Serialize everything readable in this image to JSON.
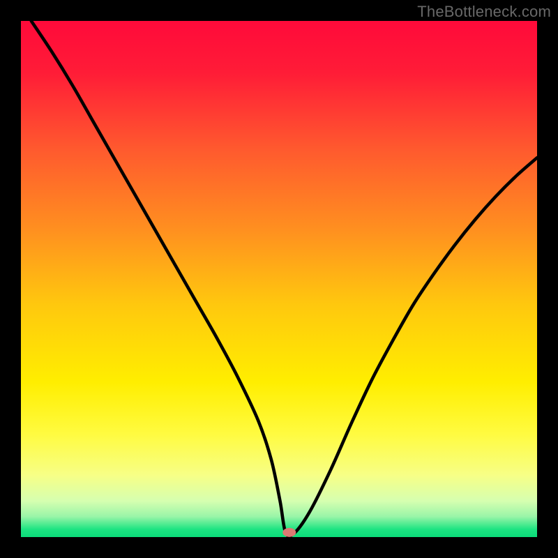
{
  "watermark": "TheBottleneck.com",
  "chart_data": {
    "type": "line",
    "title": "",
    "xlabel": "",
    "ylabel": "",
    "xlim": [
      0,
      100
    ],
    "ylim": [
      0,
      100
    ],
    "background_gradient": {
      "stops": [
        {
          "pos": 0.0,
          "color": "#ff0a3a"
        },
        {
          "pos": 0.1,
          "color": "#ff1c37"
        },
        {
          "pos": 0.25,
          "color": "#ff5a2e"
        },
        {
          "pos": 0.4,
          "color": "#ff8e20"
        },
        {
          "pos": 0.55,
          "color": "#ffc80e"
        },
        {
          "pos": 0.7,
          "color": "#ffee00"
        },
        {
          "pos": 0.8,
          "color": "#fffb40"
        },
        {
          "pos": 0.88,
          "color": "#f7ff86"
        },
        {
          "pos": 0.93,
          "color": "#d6ffb0"
        },
        {
          "pos": 0.96,
          "color": "#9af5a8"
        },
        {
          "pos": 0.985,
          "color": "#1de482"
        },
        {
          "pos": 1.0,
          "color": "#0bdc7a"
        }
      ]
    },
    "series": [
      {
        "name": "bottleneck-curve",
        "x": [
          2,
          6,
          10,
          14,
          18,
          22,
          26,
          30,
          34,
          38,
          42,
          46,
          48.5,
          50.2,
          51.3,
          53,
          56,
          60,
          64,
          68,
          72,
          76,
          80,
          84,
          88,
          92,
          96,
          100
        ],
        "y": [
          100,
          94,
          87.5,
          80.5,
          73.5,
          66.5,
          59.5,
          52.5,
          45.5,
          38.5,
          31,
          22.5,
          15,
          7,
          0.8,
          0.8,
          5,
          13,
          22,
          30.5,
          38,
          45,
          51,
          56.5,
          61.5,
          66,
          70,
          73.5
        ]
      }
    ],
    "marker": {
      "name": "optimal-point",
      "x": 52,
      "y": 0.9,
      "color": "#db7a73"
    }
  }
}
